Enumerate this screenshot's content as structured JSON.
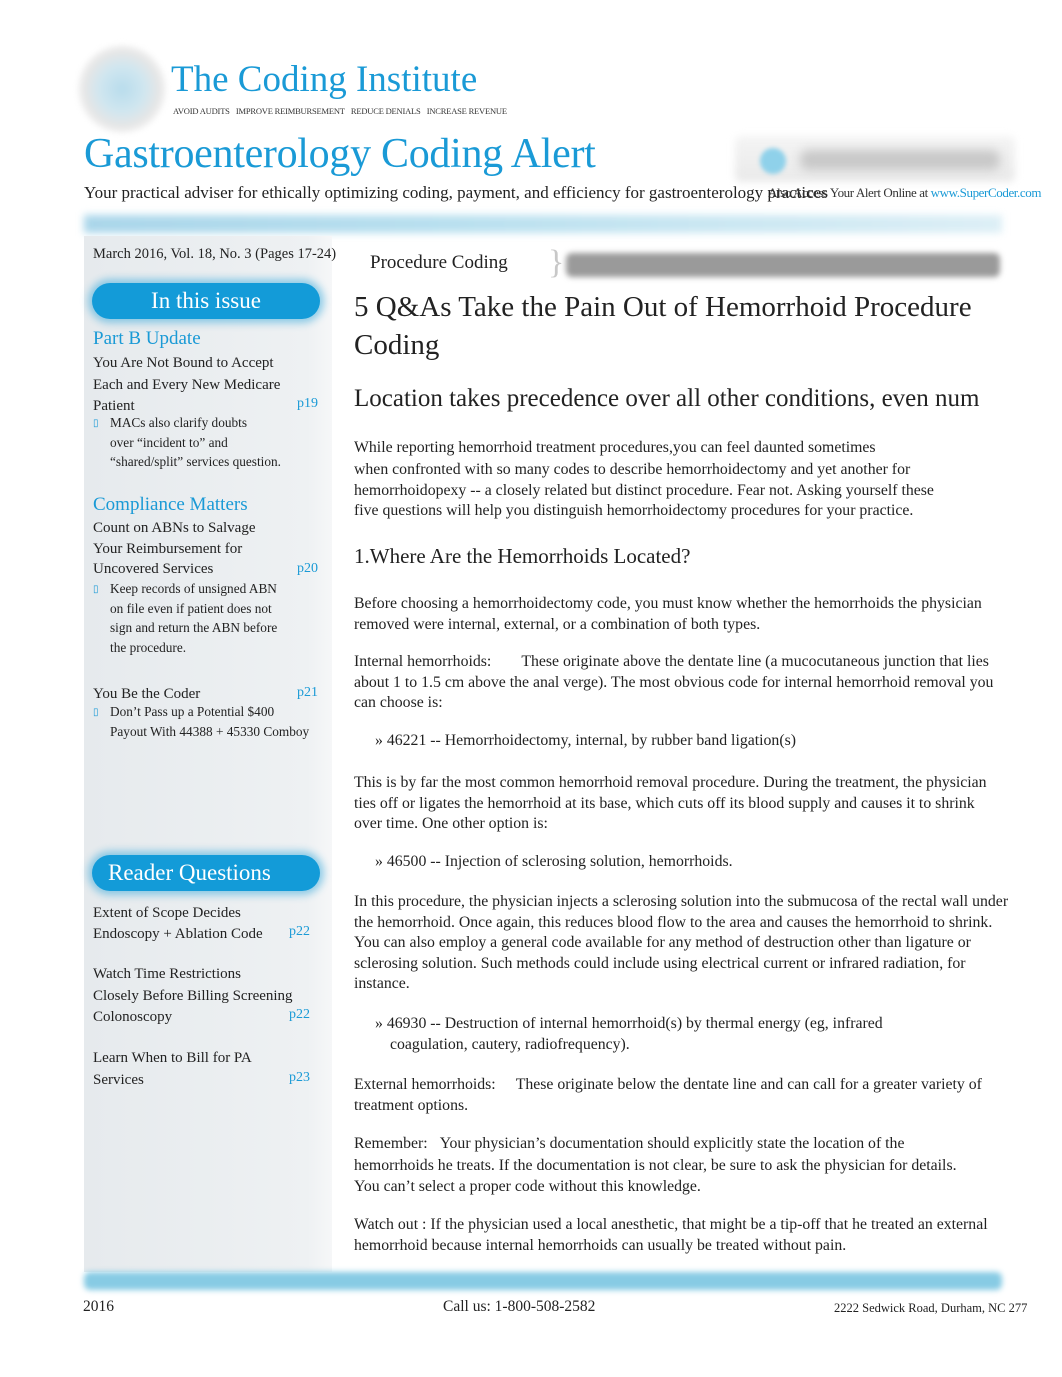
{
  "header": {
    "brand": "The Coding Institute",
    "taglines": [
      "AVOID AUDITS",
      "IMPROVE REIMBURSEMENT",
      "REDUCE DENIALS",
      "INCREASE REVENUE"
    ],
    "publication_title": "Gastroenterology Coding Alert",
    "subtitle": "Your practical adviser for ethically optimizing coding, payment, and efficiency for gastroenterology practices",
    "access_text": "Also Access Your Alert Online at",
    "access_link": "www.SuperCoder.com",
    "badge_icon": "supercoder-logo-icon"
  },
  "colors": {
    "brand_blue": "#1a9ad6",
    "pill_blue": "#139bd8",
    "rule_blue": "#87cbe4"
  },
  "sidebar": {
    "issue_date": "March 2016, Vol. 18, No. 3 (Pages 17-24)",
    "in_this_issue_label": "In this issue",
    "sections": [
      {
        "title": "Part B Update",
        "article_lines": [
          "You Are Not Bound to Accept",
          "Each and Every New Medicare",
          "Patient"
        ],
        "page": "p19",
        "bullet_lines": [
          "MACs also clarify doubts",
          "over “incident to” and",
          "“shared/split” services question."
        ]
      },
      {
        "title": "Compliance Matters",
        "article_lines": [
          "Count on ABNs to Salvage",
          "Your Reimbursement for",
          "Uncovered Services"
        ],
        "page": "p20",
        "bullet_lines": [
          "Keep records of unsigned ABN",
          "on file even if patient does not",
          "sign and return the ABN before",
          "the procedure."
        ]
      },
      {
        "title": "You Be the Coder",
        "page": "p21",
        "bullet_lines": [
          "Don’t Pass up a Potential $400",
          "Payout With 44388 + 45330 Comboy"
        ]
      }
    ],
    "reader_questions_label": "Reader Questions",
    "reader_questions": [
      {
        "lines": [
          "Extent of Scope Decides",
          "Endoscopy + Ablation Code"
        ],
        "page": "p22"
      },
      {
        "lines": [
          "Watch Time Restrictions",
          "Closely Before Billing Screening",
          "Colonoscopy"
        ],
        "page": "p22"
      },
      {
        "lines": [
          "Learn When to Bill for PA",
          "Services"
        ],
        "page": "p23"
      }
    ]
  },
  "main": {
    "section_label": "Procedure Coding",
    "title": "5 Q&As Take the Pain Out of Hemorrhoid Procedure Coding",
    "deck": "Location takes precedence over all other conditions, even num",
    "intro_lines": [
      "While reporting hemorrhoid treatment procedures,you can feel daunted sometimes",
      "when confronted with so many codes to describe hemorrhoidectomy and yet another for",
      "hemorrhoidopexy -- a closely related but distinct procedure. Fear not. Asking yourself these",
      "five questions will help you distinguish hemorrhoidectomy procedures for your practice."
    ],
    "question1": "1.Where Are the Hemorrhoids Located?",
    "p_before": "Before choosing a hemorrhoidectomy code, you must know whether the hemorrhoids the physician removed were internal, external, or a combination of both types.",
    "internal_label": "Internal hemorrhoids:",
    "internal_text": "These originate above the dentate line (a mucocutaneous junction that lies about 1 to 1.5 cm above the anal verge). The most obvious code for internal hemorrhoid removal you can choose is:",
    "code1": "» 46221 -- Hemorrhoidectomy, internal, by rubber band ligation(s)",
    "p_common": "This is by far the most common hemorrhoid removal procedure. During the treatment, the physician ties off or ligates the hemorrhoid at its base, which cuts off its blood supply and causes it to shrink over time. One other option is:",
    "code2": "» 46500 -- Injection of sclerosing solution, hemorrhoids.",
    "p_injects": "In this procedure, the physician injects a sclerosing solution into the submucosa of the rectal wall under the hemorrhoid. Once again, this reduces blood flow to the area and causes the hemorrhoid to shrink. You can also employ a general code available for any method of destruction other than ligature or sclerosing solution. Such methods could include using electrical current or infrared radiation, for instance.",
    "code3_line1": "» 46930 -- Destruction of internal hemorrhoid(s) by thermal energy (eg, infrared",
    "code3_line2": "coagulation, cautery, radiofrequency).",
    "external_label": "External hemorrhoids:",
    "external_text": "These originate below the dentate line and can call for a greater variety of treatment options.",
    "remember_label": "Remember:",
    "remember_text": "Your physician’s documentation should explicitly state the location of the hemorrhoids he treats. If the documentation is not clear, be sure to ask the physician for details. You can’t select a proper code without this knowledge.",
    "watch_label": "Watch out :",
    "watch_text": "If the physician used a local anesthetic, that might be a tip-off that he treated an external hemorrhoid because internal hemorrhoids can usually be treated without pain."
  },
  "footer": {
    "year": "2016",
    "phone": "Call us: 1-800-508-2582",
    "address": "2222 Sedwick Road, Durham, NC 277"
  }
}
